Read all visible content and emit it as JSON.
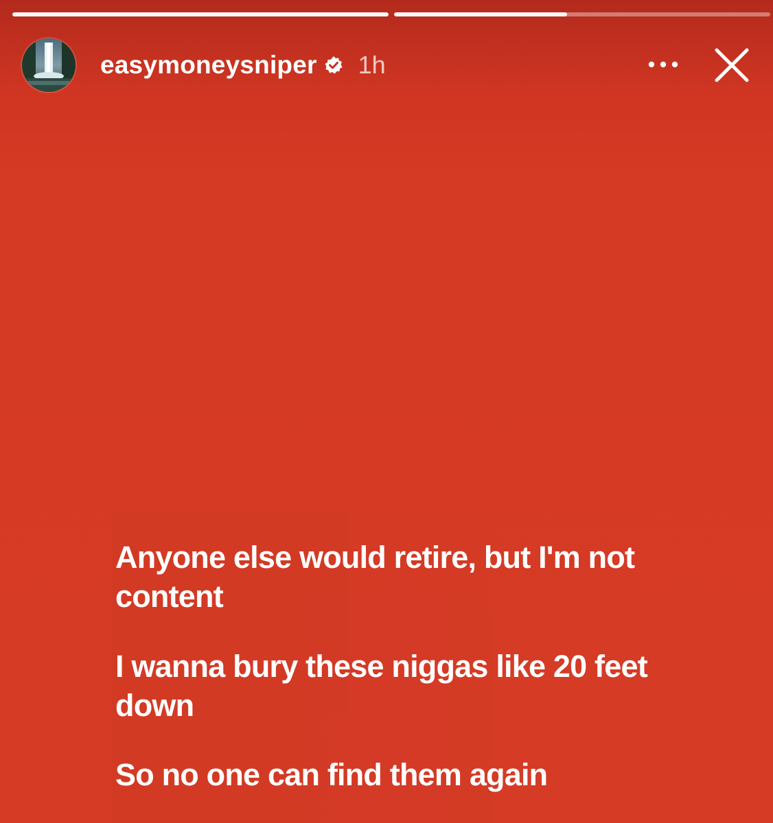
{
  "progress": {
    "segments": [
      {
        "fill": 1.0
      },
      {
        "fill": 0.46
      }
    ]
  },
  "header": {
    "username": "easymoneysniper",
    "verified": true,
    "time": "1h",
    "avatar_icon": "waterfall-avatar",
    "more_icon": "more-horizontal-icon",
    "close_icon": "close-icon"
  },
  "lyrics": [
    "Anyone else would retire, but I'm not content",
    "I wanna bury these niggas like 20 feet down",
    "So no one can find them again"
  ],
  "colors": {
    "background": "#d53a24",
    "header_background": "#b32a1c",
    "text": "#ffffff"
  }
}
